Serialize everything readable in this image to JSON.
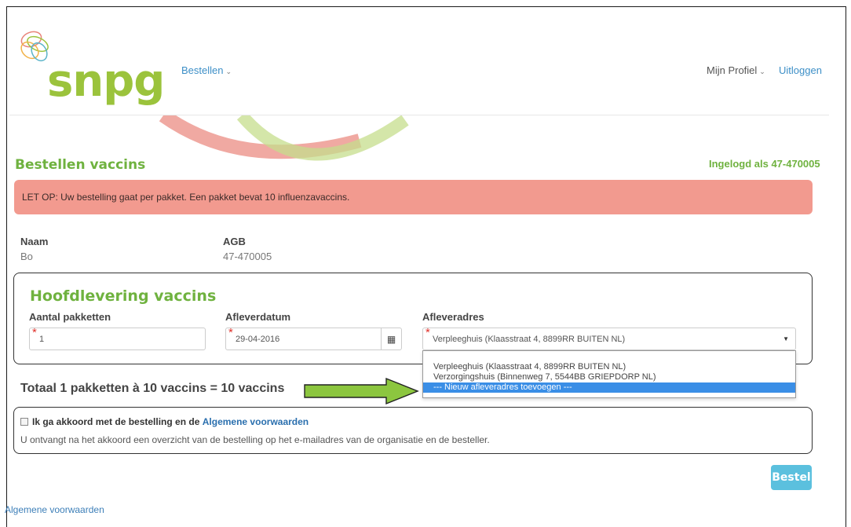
{
  "header": {
    "logo_text": "snpg",
    "nav_bestellen": "Bestellen",
    "nav_profiel": "Mijn Profiel",
    "nav_uitloggen": "Uitloggen"
  },
  "page": {
    "title": "Bestellen vaccins",
    "logged_in": "Ingelogd als 47-470005",
    "alert": "LET OP: Uw bestelling gaat per pakket. Een pakket bevat 10 influenzavaccins."
  },
  "info": {
    "naam_label": "Naam",
    "naam_value": "Bo",
    "agb_label": "AGB",
    "agb_value": "47-470005"
  },
  "form": {
    "panel_title": "Hoofdlevering vaccins",
    "aantal_label": "Aantal pakketten",
    "aantal_value": "1",
    "datum_label": "Afleverdatum",
    "datum_value": "29-04-2016",
    "adres_label": "Afleveradres",
    "adres_value": "Verpleeghuis (Klaasstraat 4, 8899RR BUITEN NL)",
    "adres_options": [
      "Verpleeghuis (Klaasstraat 4, 8899RR BUITEN NL)",
      "Verzorgingshuis (Binnenweg 7, 5544BB GRIEPDORP NL)",
      "--- Nieuw afleveradres toevoegen ---"
    ]
  },
  "summary": {
    "total": "Totaal 1 pakketten à 10 vaccins = 10 vaccins"
  },
  "agreement": {
    "label_prefix": "Ik ga akkoord met de bestelling en de",
    "label_link": "Algemene voorwaarden",
    "note": "U ontvangt na het akkoord een overzicht van de bestelling op het e-mailadres van de organisatie en de besteller."
  },
  "actions": {
    "submit": "Bestel"
  },
  "footer": {
    "link": "Algemene voorwaarden"
  },
  "colors": {
    "brand_green": "#9bc33c",
    "title_green": "#6fb23f",
    "alert_bg": "#f29a8f",
    "button": "#5bc0de",
    "link": "#3d8fc7",
    "arrow_green": "#8cc63f",
    "selected_option": "#3a8ee6"
  }
}
